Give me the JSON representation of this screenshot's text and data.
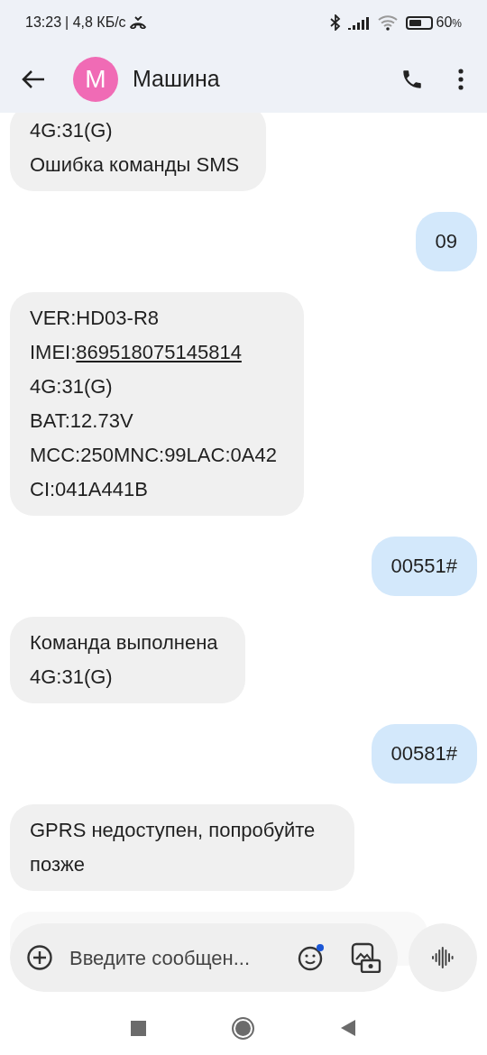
{
  "status_bar": {
    "time": "13:23",
    "speed": "| 4,8 КБ/с",
    "battery": "60",
    "battery_unit": "%"
  },
  "header": {
    "avatar_letter": "М",
    "title": "Машина"
  },
  "messages": [
    {
      "kind": "received",
      "lines": [
        {
          "text": "4G:31(G)"
        },
        {
          "text": "Ошибка команды SMS"
        }
      ]
    },
    {
      "kind": "sent",
      "lines": [
        {
          "text": "09"
        }
      ]
    },
    {
      "kind": "received",
      "lines": [
        {
          "text": "VER:HD03-R8"
        },
        {
          "text": "IMEI:",
          "link": "869518075145814"
        },
        {
          "text": "4G:31(G)"
        },
        {
          "text": "BAT:12.73V"
        },
        {
          "text": "MCC:250MNC:99LAC:0A42"
        },
        {
          "text": "CI:041A441B"
        }
      ]
    },
    {
      "kind": "sent",
      "lines": [
        {
          "text": "00551#"
        }
      ]
    },
    {
      "kind": "received",
      "lines": [
        {
          "text": "Команда выполнена"
        },
        {
          "text": "4G:31(G)"
        }
      ]
    },
    {
      "kind": "sent",
      "lines": [
        {
          "text": "00581#"
        }
      ]
    },
    {
      "kind": "received",
      "lines": [
        {
          "text": "GPRS недоступен, попробуйте позже"
        }
      ]
    },
    {
      "kind": "faded"
    }
  ],
  "composer": {
    "placeholder": "Введите сообщен...",
    "emoji_badge": true
  }
}
